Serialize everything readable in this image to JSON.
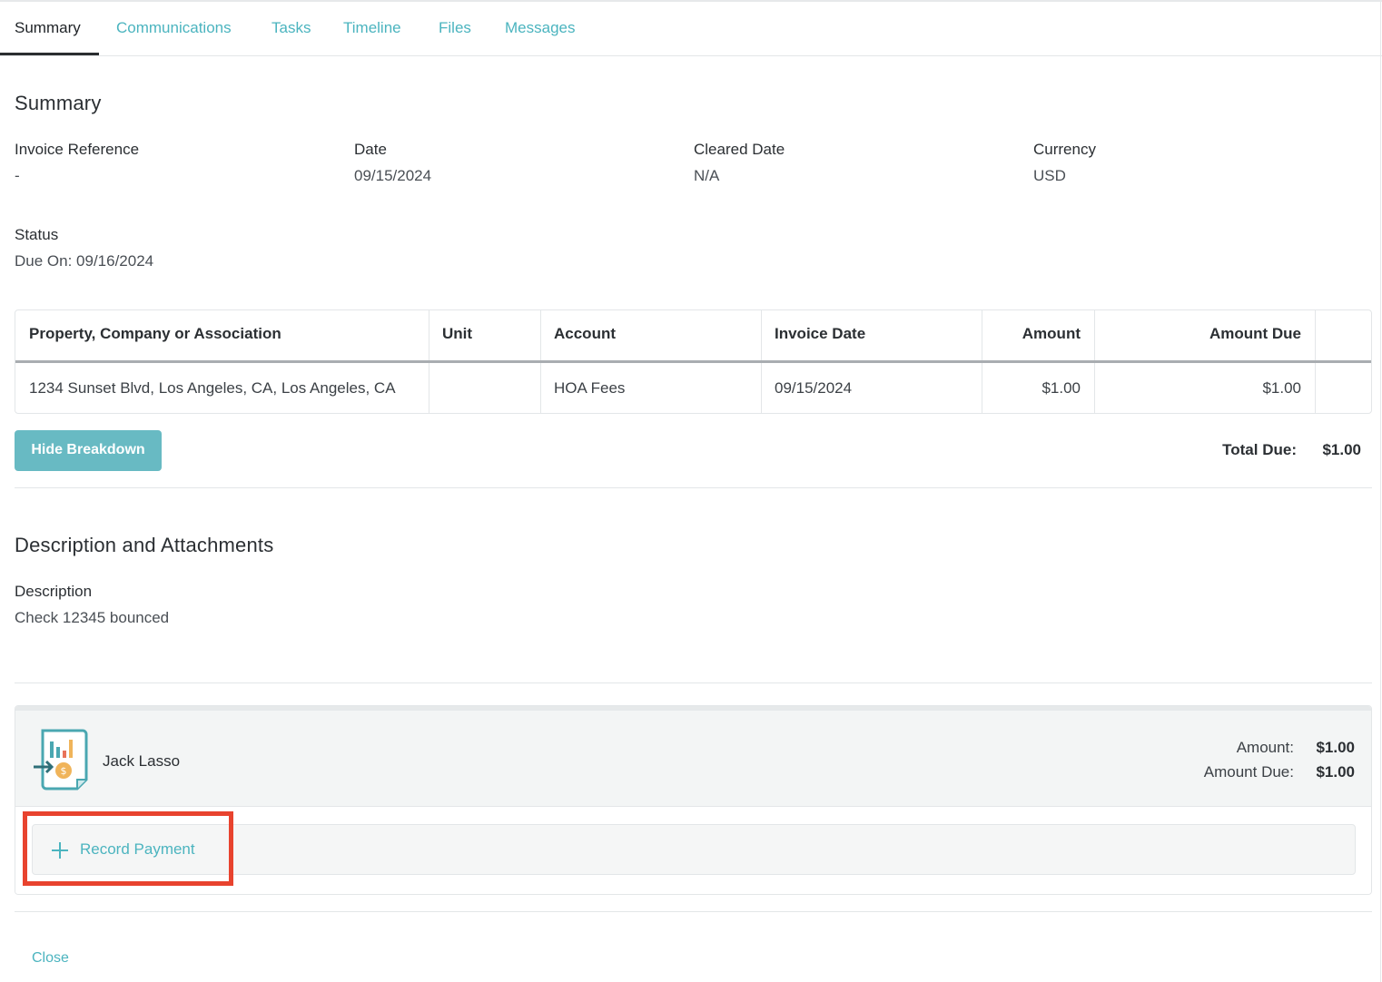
{
  "tabs": [
    "Summary",
    "Communications",
    "Tasks",
    "Timeline",
    "Files",
    "Messages"
  ],
  "summary": {
    "heading": "Summary",
    "fields": [
      {
        "label": "Invoice Reference",
        "value": "-"
      },
      {
        "label": "Date",
        "value": "09/15/2024"
      },
      {
        "label": "Cleared Date",
        "value": "N/A"
      },
      {
        "label": "Currency",
        "value": "USD"
      }
    ],
    "status_label": "Status",
    "status_value": "Due On: 09/16/2024"
  },
  "table": {
    "columns": [
      "Property, Company or Association",
      "Unit",
      "Account",
      "Invoice Date",
      "Amount",
      "Amount Due"
    ],
    "rows": [
      [
        "1234 Sunset Blvd, Los Angeles, CA, Los Angeles, CA",
        "",
        "HOA Fees",
        "09/15/2024",
        "$1.00",
        "$1.00"
      ]
    ]
  },
  "breakdown_button": "Hide Breakdown",
  "total": {
    "label": "Total Due:",
    "value": "$1.00"
  },
  "description_section": {
    "heading": "Description and Attachments",
    "label": "Description",
    "value": "Check 12345 bounced"
  },
  "payment_card": {
    "icon": "invoice-chart-icon",
    "name": "Jack Lasso",
    "amount_label": "Amount:",
    "amount_value": "$1.00",
    "amount_due_label": "Amount Due:",
    "amount_due_value": "$1.00",
    "record_payment_label": "Record Payment",
    "record_payment_icon": "plus-icon"
  },
  "close_label": "Close",
  "colors": {
    "accent": "#4bb4bf",
    "button": "#68bac3",
    "highlight": "#e8432e"
  }
}
